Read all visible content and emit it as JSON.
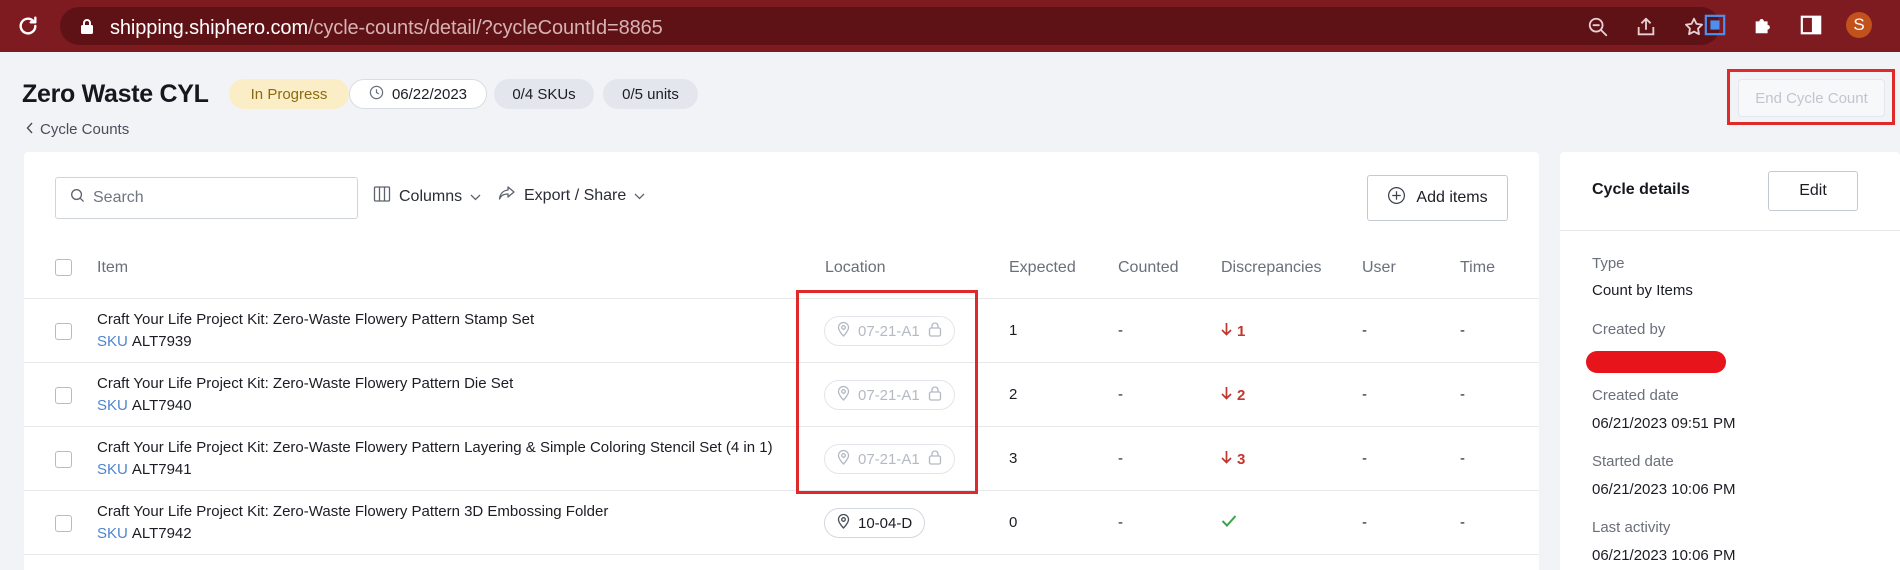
{
  "browser": {
    "url_host": "shipping.shiphero.com",
    "url_path": "/cycle-counts/detail/?cycleCountId=8865",
    "profile_initial": "S"
  },
  "header": {
    "title": "Zero Waste CYL",
    "status": "In Progress",
    "date": "06/22/2023",
    "skus": "0/4 SKUs",
    "units": "0/5 units",
    "back_label": "Cycle Counts",
    "end_button": "End Cycle Count"
  },
  "toolbar": {
    "search_placeholder": "Search",
    "columns_label": "Columns",
    "export_label": "Export / Share",
    "add_items_label": "Add items"
  },
  "table": {
    "columns": [
      "Item",
      "Location",
      "Expected",
      "Counted",
      "Discrepancies",
      "User",
      "Time"
    ],
    "sku_label": "SKU",
    "rows": [
      {
        "name": "Craft Your Life Project Kit: Zero-Waste Flowery Pattern Stamp Set",
        "sku": "ALT7939",
        "location": "07-21-A1",
        "locked": true,
        "expected": "1",
        "counted": "-",
        "discrepancy": "1",
        "discrepancy_type": "down",
        "user": "-",
        "time": "-"
      },
      {
        "name": "Craft Your Life Project Kit: Zero-Waste Flowery Pattern Die Set",
        "sku": "ALT7940",
        "location": "07-21-A1",
        "locked": true,
        "expected": "2",
        "counted": "-",
        "discrepancy": "2",
        "discrepancy_type": "down",
        "user": "-",
        "time": "-"
      },
      {
        "name": "Craft Your Life Project Kit: Zero-Waste Flowery Pattern Layering & Simple Coloring Stencil Set (4 in 1)",
        "sku": "ALT7941",
        "location": "07-21-A1",
        "locked": true,
        "expected": "3",
        "counted": "-",
        "discrepancy": "3",
        "discrepancy_type": "down",
        "user": "-",
        "time": "-"
      },
      {
        "name": "Craft Your Life Project Kit: Zero-Waste Flowery Pattern 3D Embossing Folder",
        "sku": "ALT7942",
        "location": "10-04-D",
        "locked": false,
        "expected": "0",
        "counted": "-",
        "discrepancy": "",
        "discrepancy_type": "ok",
        "user": "-",
        "time": "-"
      }
    ]
  },
  "side": {
    "title": "Cycle details",
    "edit_label": "Edit",
    "type_label": "Type",
    "type_value": "Count by Items",
    "created_by_label": "Created by",
    "created_date_label": "Created date",
    "created_date_value": "06/21/2023 09:51 PM",
    "started_date_label": "Started date",
    "started_date_value": "06/21/2023 10:06 PM",
    "last_activity_label": "Last activity",
    "last_activity_value": "06/21/2023 10:06 PM"
  },
  "colors": {
    "browser_bar": "#7e1b21",
    "status_pill": "#fbeec6",
    "discrepancy": "#c2362b",
    "ok_check": "#3fa14a",
    "highlight": "#e02a2a"
  }
}
